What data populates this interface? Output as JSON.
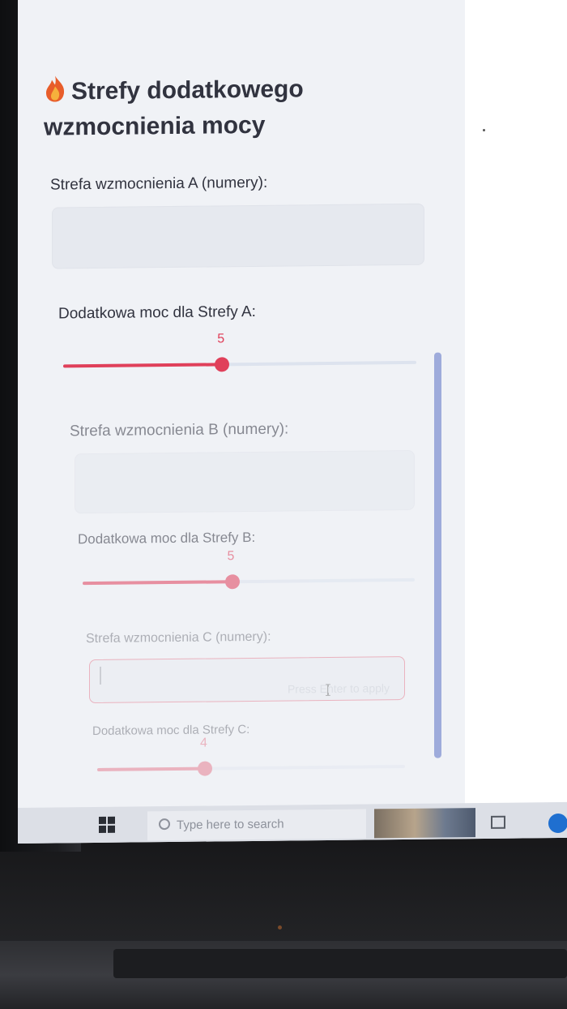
{
  "sidebar": {
    "header": {
      "title": "Strefy dodatkowego wzmocnienia mocy",
      "icon": "flame-icon"
    },
    "zones": [
      {
        "input_label": "Strefa wzmocnienia A (numery):",
        "input_value": "",
        "slider_label": "Dodatkowa moc dla Strefy A:",
        "slider_value": "5",
        "slider_fraction": 0.45
      },
      {
        "input_label": "Strefa wzmocnienia B (numery):",
        "input_value": "",
        "slider_label": "Dodatkowa moc dla Strefy B:",
        "slider_value": "5",
        "slider_fraction": 0.45
      },
      {
        "input_label": "Strefa wzmocnienia C (numery):",
        "input_value": "",
        "input_placeholder": "Press Enter to apply",
        "slider_label": "Dodatkowa moc dla Strefy C:",
        "slider_value": "4",
        "slider_fraction": 0.35
      }
    ]
  },
  "taskbar": {
    "search_placeholder": "Type here to search",
    "start_icon": "windows-icon",
    "search_icon": "search-icon"
  },
  "colors": {
    "accent": "#e0405a",
    "sidebar_bg": "#f0f2f6",
    "text": "#31333f",
    "scrollbar": "#8f9fd6"
  }
}
